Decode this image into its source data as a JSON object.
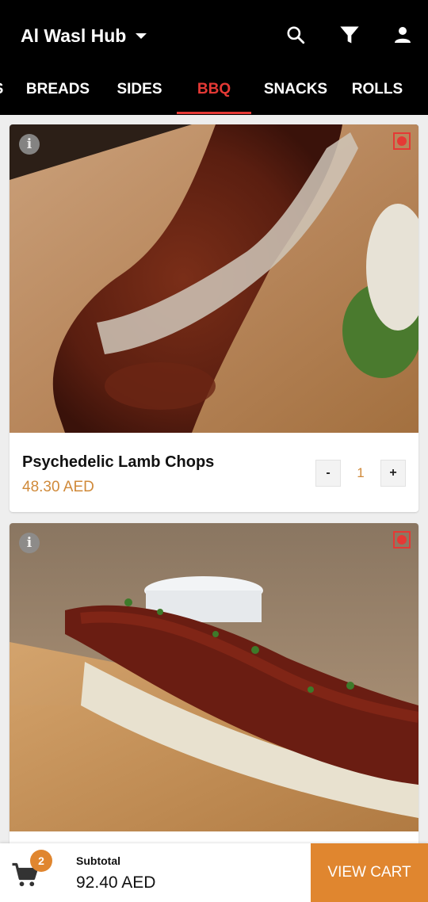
{
  "header": {
    "title": "Al Wasl Hub",
    "icons": [
      "search-icon",
      "filter-icon",
      "user-icon"
    ]
  },
  "tabs": [
    {
      "label": "S"
    },
    {
      "label": "BREADS"
    },
    {
      "label": "SIDES"
    },
    {
      "label": "BBQ",
      "active": true
    },
    {
      "label": "SNACKS"
    },
    {
      "label": "ROLLS"
    }
  ],
  "items": [
    {
      "name": "Psychedelic Lamb Chops",
      "price": "48.30 AED",
      "quantity": "1",
      "minus": "-",
      "plus": "+",
      "info_icon": "i"
    },
    {
      "info_icon": "i"
    }
  ],
  "cart": {
    "count": "2",
    "subtotal_label": "Subtotal",
    "subtotal": "92.40 AED",
    "view_cart": "VIEW CART"
  },
  "colors": {
    "header_bg": "#000000",
    "active_tab": "#e53935",
    "price": "#d08a3a",
    "accent": "#e0862f"
  }
}
